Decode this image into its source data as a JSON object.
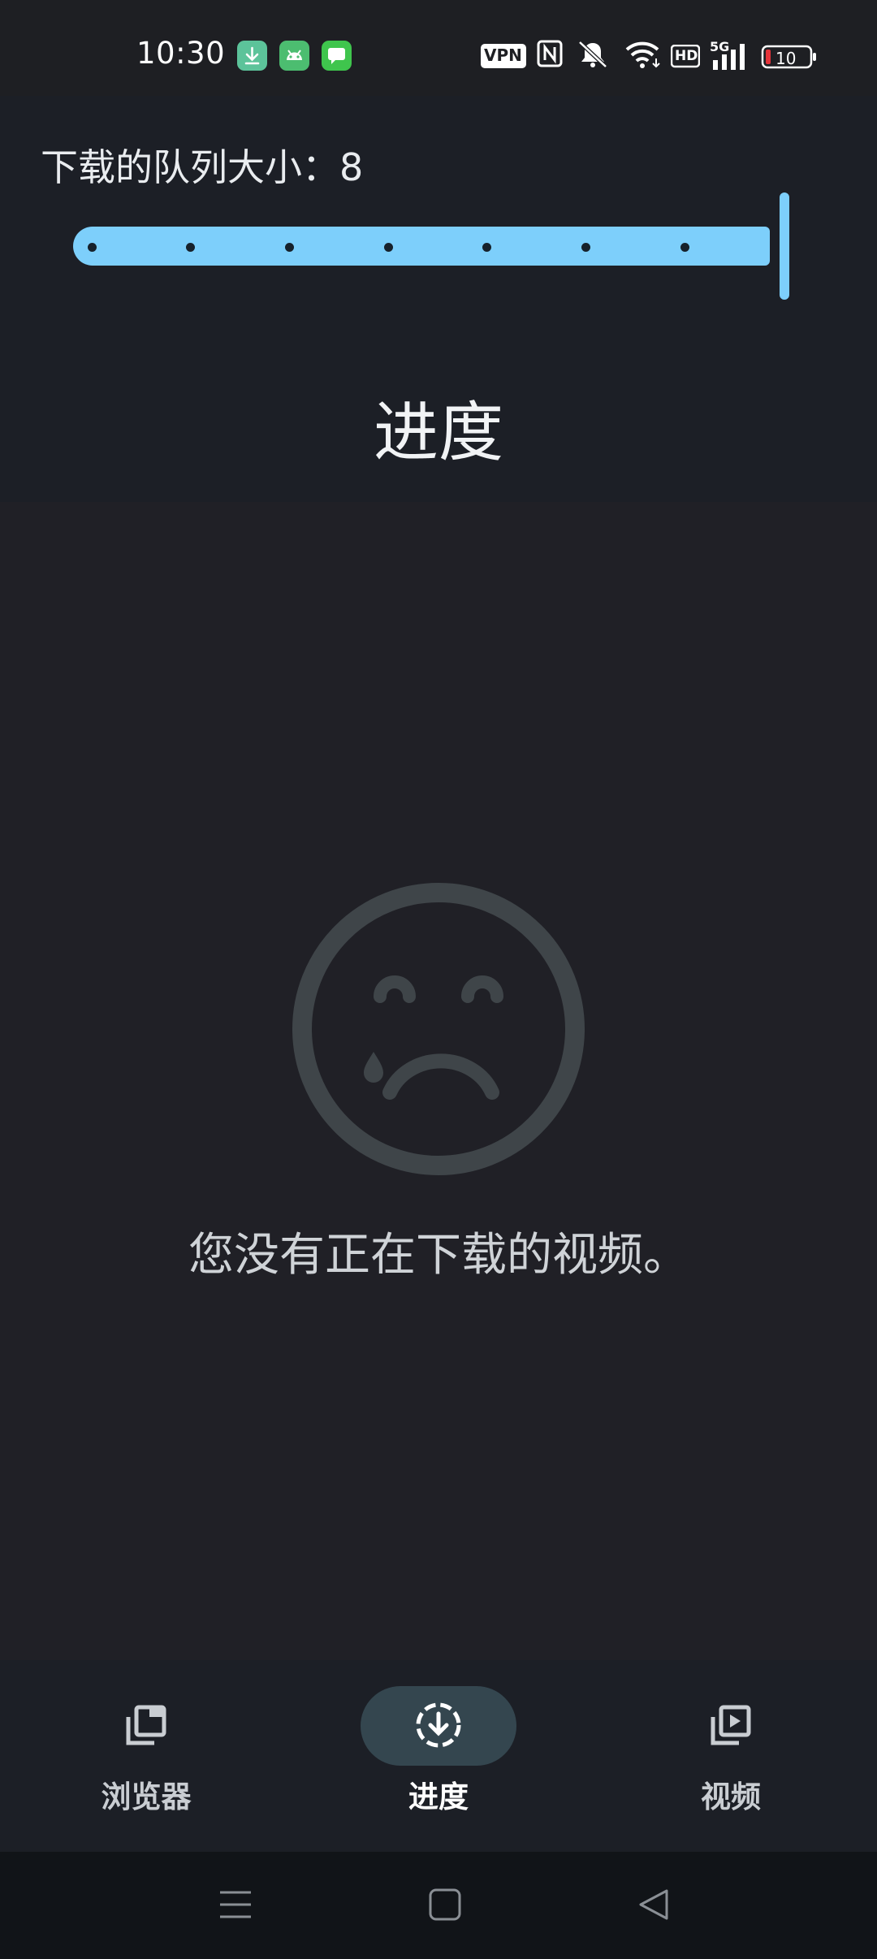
{
  "status_bar": {
    "time": "10:30",
    "vpn_label": "VPN",
    "hd_label": "HD",
    "network_label": "5G",
    "battery_level": "10",
    "icons": [
      "download-notification-icon",
      "android-notification-icon",
      "message-notification-icon",
      "nfc-icon",
      "mute-icon",
      "wifi-icon",
      "signal-icon",
      "battery-icon"
    ]
  },
  "header": {
    "queue_label": "下载的队列大小：8",
    "queue_size": 8,
    "slider_max": 8,
    "title": "进度"
  },
  "empty_state": {
    "icon": "sad-face-icon",
    "message": "您没有正在下载的视频。"
  },
  "bottom_nav": {
    "items": [
      {
        "label": "浏览器",
        "icon": "browser-tabs-icon",
        "active": false
      },
      {
        "label": "进度",
        "icon": "download-progress-icon",
        "active": true
      },
      {
        "label": "视频",
        "icon": "video-library-icon",
        "active": false
      }
    ]
  },
  "system_nav": {
    "icons": [
      "menu-icon",
      "home-icon",
      "back-icon"
    ]
  },
  "colors": {
    "accent": "#7dcffb",
    "background": "#202026",
    "header_background": "#1c1f26",
    "active_pill": "#34464f",
    "battery_low": "#e5343a"
  }
}
